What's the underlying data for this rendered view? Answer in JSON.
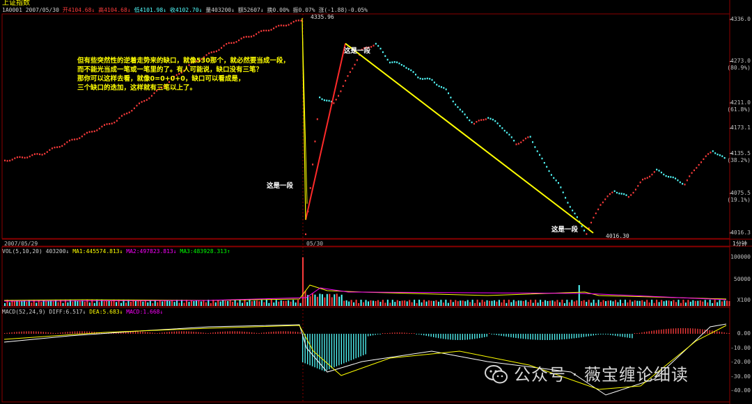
{
  "header": {
    "title": "上证指数",
    "code_date": "1A0001 2007/05/30",
    "open_label": "开",
    "open": "4104.68",
    "high_label": "高",
    "high": "4104.68",
    "low_label": "低",
    "low": "4101.98",
    "close_label": "收",
    "close": "4102.70",
    "volume_label": "量",
    "volume": "403200",
    "amount_label": "额",
    "amount": "52607",
    "turnover_label": "换",
    "turnover": "0.00%",
    "amplitude_label": "振",
    "amplitude": "0.07%",
    "change_label": "涨",
    "change": "(-1.88)-0.05%"
  },
  "dates": {
    "left": "2007/05/29",
    "mid": "05/30",
    "period": "1分钟"
  },
  "annotation_lines": [
    "但有些突然性的逆着走势来的缺口，就像530那个，就必然要当成一段，",
    "而不能光当成一笔或一笔里的了。有人可能说，缺口没有三笔？",
    "那你可以这样去看，就像0=0+0+0，缺口可以看成是，",
    "三个缺口的迭加，这样就有三笔以上了。"
  ],
  "segment_labels": {
    "top": "这是一段",
    "left": "这是一段",
    "bottom": "这是一段"
  },
  "price_markers": {
    "peak": "4335.96",
    "trough": "4016.30"
  },
  "price_axis": [
    {
      "v": "4336.0",
      "p": ""
    },
    {
      "v": "4273.0",
      "p": "(80.9%)"
    },
    {
      "v": "4211.0",
      "p": "(61.8%)"
    },
    {
      "v": "4173.1",
      "p": ""
    },
    {
      "v": "4135.5",
      "p": "(38.2%)"
    },
    {
      "v": "4075.5",
      "p": "(19.1%)"
    },
    {
      "v": "4016.3",
      "p": ""
    }
  ],
  "volume_legend": {
    "vol": "VOL(5,10,20)",
    "vol_val": "403200",
    "ma1": "MA1:445574.813",
    "ma2": "MA2:497823.813",
    "ma3": "MA3:483928.313"
  },
  "volume_axis": [
    "100000",
    "50000",
    "X100"
  ],
  "macd_legend": {
    "name": "MACD(52,24,9)",
    "diff": "DIFF:6.517",
    "dea": "DEA:5.683",
    "macd": "MACD:1.668"
  },
  "macd_axis": [
    "0.00",
    "-10.00",
    "-20.00",
    "-30.00",
    "-40.00"
  ],
  "watermark": "公众号 · 薇宝缠论细读",
  "colors": {
    "up": "#ff3c3c",
    "down": "#54ffff",
    "yellow": "#ffff00",
    "ma2": "#ff00ff",
    "ma3": "#00ff00",
    "grid": "#8b0000"
  },
  "chart_data": {
    "type": "line",
    "title": "上证指数",
    "ylim": [
      4016.3,
      4336.0
    ],
    "x": [
      "2007/05/29",
      "05/30"
    ],
    "series": [
      {
        "name": "",
        "values": [
          4125,
          4135,
          4160,
          4185,
          4225,
          4270,
          4300,
          4320,
          4336,
          4016,
          4220,
          4210,
          4250,
          4290,
          4300,
          4273,
          4268,
          4250,
          4245,
          4230,
          4200,
          4180,
          4190,
          4175,
          4150,
          4160,
          4120,
          4090,
          4050,
          4016,
          4060,
          4080,
          4070,
          4095,
          4110,
          4100,
          4090,
          4120,
          4140,
          4125
        ]
      }
    ]
  }
}
